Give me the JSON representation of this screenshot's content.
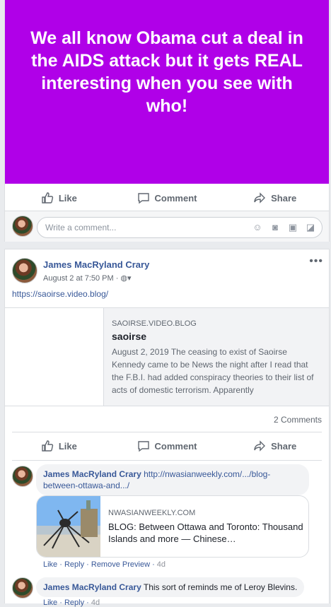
{
  "post1": {
    "headline": "We all know Obama cut a deal in the AIDS attack but it gets REAL interesting when you see with who!",
    "actions": {
      "like": "Like",
      "comment": "Comment",
      "share": "Share"
    },
    "comment_placeholder": "Write a comment..."
  },
  "post2": {
    "author": "James MacRyland Crary",
    "time": "August 2 at 7:50 PM ·",
    "menu": "•••",
    "link_text": "https://saoirse.video.blog/",
    "preview": {
      "domain": "SAOIRSE.VIDEO.BLOG",
      "title": "saoirse",
      "description": "August 2, 2019       The ceasing to exist of Saoirse Kennedy came to be News the night after I read that the F.B.I. had added conspiracy theories to their list of acts of domestic terrorism.   Apparently"
    },
    "comments_count": "2 Comments",
    "actions": {
      "like": "Like",
      "comment": "Comment",
      "share": "Share"
    },
    "comments": [
      {
        "author": "James MacRyland Crary",
        "text": "http://nwasianweekly.com/.../blog-between-ottawa-and.../",
        "link_card": {
          "domain": "NWASIANWEEKLY.COM",
          "title": "BLOG: Between Ottawa and Toronto: Thousand Islands and more — Chinese…"
        },
        "meta": {
          "like": "Like",
          "reply": "Reply",
          "remove": "Remove Preview",
          "age": "4d"
        }
      },
      {
        "author": "James MacRyland Crary",
        "text": "This sort of reminds me of Leroy Blevins.",
        "meta": {
          "like": "Like",
          "reply": "Reply",
          "age": "4d"
        }
      }
    ]
  },
  "colors": {
    "banner": "#b000e8",
    "link": "#385898",
    "muted": "#606770"
  }
}
